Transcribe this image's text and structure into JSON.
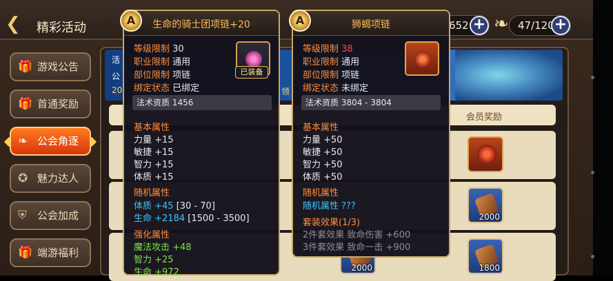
{
  "header": {
    "back_icon": "back-arrow-icon",
    "title": "精彩活动",
    "currency1_value": "652",
    "currency2_value": "47/120"
  },
  "sidebar": {
    "items": [
      {
        "label": "游戏公告",
        "icon": "gift-icon",
        "active": false
      },
      {
        "label": "首通奖励",
        "icon": "gift-icon",
        "active": false
      },
      {
        "label": "公会角逐",
        "icon": "wings-icon",
        "active": true
      },
      {
        "label": "魅力达人",
        "icon": "star-icon",
        "active": false
      },
      {
        "label": "公会加成",
        "icon": "shield-icon",
        "active": false
      },
      {
        "label": "端游福利",
        "icon": "gift-icon",
        "active": false
      }
    ]
  },
  "banner": {
    "t1": "活",
    "t2": "公",
    "t3": "20",
    "t4": "领"
  },
  "table": {
    "header_label": "会员奖励",
    "rows": [
      {
        "qty": ""
      },
      {
        "qty": "2000"
      },
      {
        "qty": "1800"
      }
    ],
    "mid_qty": "2000"
  },
  "tooltip_left": {
    "badge": "A",
    "title": "生命的骑士团项链+20",
    "level_label": "等级限制",
    "level_value": "30",
    "class_label": "职业限制",
    "class_value": "通用",
    "slot_label": "部位限制",
    "slot_value": "项链",
    "bind_label": "绑定状态",
    "bind_value": "已绑定",
    "equipped_tag": "已装备",
    "spell_bar": "法术资质  1456",
    "base_title": "基本属性",
    "base_stats": [
      "力量 +15",
      "敏捷 +15",
      "智力 +15",
      "体质 +15"
    ],
    "random_title": "随机属性",
    "random_stats": [
      "体质 +45",
      "[30 - 70]",
      "生命 +2184",
      "[1500 - 3500]"
    ],
    "enhance_title": "强化属性",
    "enhance_stats": [
      "魔法攻击 +48",
      "智力 +25",
      "生命 +972"
    ]
  },
  "tooltip_right": {
    "badge": "A",
    "title": "狮蝎项链",
    "level_label": "等级限制",
    "level_value": "38",
    "class_label": "职业限制",
    "class_value": "通用",
    "slot_label": "部位限制",
    "slot_value": "项链",
    "bind_label": "绑定状态",
    "bind_value": "未绑定",
    "spell_bar": "法术资质  3804 - 3804",
    "base_title": "基本属性",
    "base_stats": [
      "力量 +50",
      "敏捷 +50",
      "智力 +50",
      "体质 +50"
    ],
    "random_title": "随机属性",
    "random_stat": "随机属性 ???",
    "set_title": "套装效果(1/3)",
    "set_stats": [
      "2件套效果 致命伤害 +600",
      "3件套效果 致命一击 +900"
    ]
  },
  "colors": {
    "accent_orange": "#ff8e3c",
    "tooltip_border": "#c9a86a",
    "active_tab": "#d9350d"
  }
}
